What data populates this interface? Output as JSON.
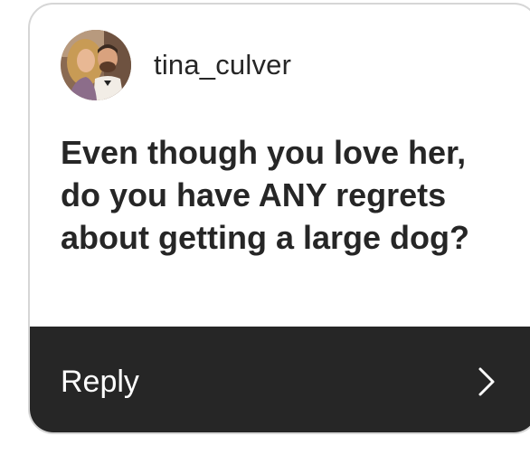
{
  "story_reply": {
    "username": "tina_culver",
    "avatar_icon": "profile-photo-couple",
    "question": "Even though you love her, do you have ANY regrets about getting a large dog?",
    "reply_label": "Reply",
    "reply_icon": "chevron-right-icon"
  },
  "colors": {
    "text": "#262626",
    "reply_bar": "#262626",
    "reply_text": "#ffffff",
    "card_border": "#d6d6d6"
  }
}
